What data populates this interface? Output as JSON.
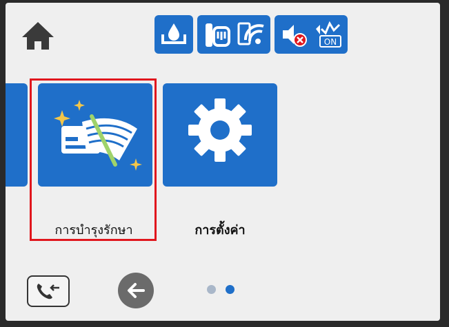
{
  "header": {
    "home_icon": "home-icon",
    "status_icons": [
      "ink-drop-icon",
      "fax-phone-icon",
      "wifi-direct-icon",
      "sound-off-icon",
      "on-indicator-icon"
    ],
    "on_label": "ON"
  },
  "tiles": [
    {
      "label": "การบำรุงรักษา",
      "icon": "maintenance-icon",
      "selected": true
    },
    {
      "label": "การตั้งค่า",
      "icon": "gear-icon",
      "selected": false
    }
  ],
  "footer": {
    "call_icon": "call-log-icon",
    "back_icon": "back-arrow-icon",
    "page_indicator": {
      "pages": 2,
      "current": 2
    }
  },
  "colors": {
    "tile_blue": "#1f6fc9",
    "screen_bg": "#efefef",
    "selection_red": "#e0161d",
    "dot_active": "#1f6fc9",
    "dot_inactive": "#a9b7c9"
  }
}
